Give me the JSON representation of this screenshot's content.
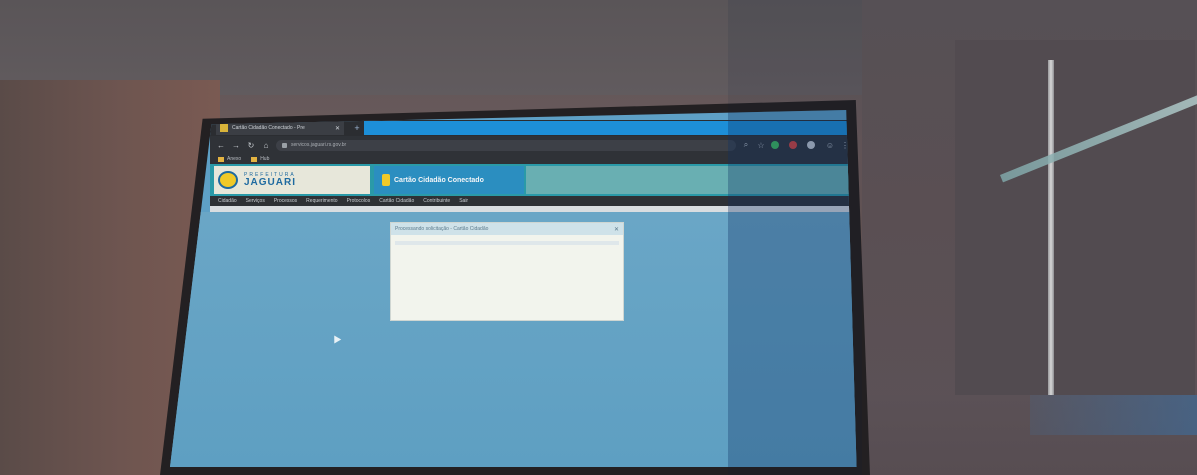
{
  "browser": {
    "tab_title": "Cartão Cidadão Conectado - Pre",
    "url": "servicos.jaguari.rs.gov.br",
    "bookmarks": [
      "Anexo",
      "Hub"
    ]
  },
  "site": {
    "logo_top": "PREFEITURA",
    "logo_name": "JAGUARI",
    "banner_title": "Cartão Cidadão Conectado",
    "menu": [
      "Cidadão",
      "Serviços",
      "Processos",
      "Requerimento",
      "Protocolos",
      "Cartão Cidadão",
      "Contribuinte",
      "Sair"
    ]
  },
  "dialog": {
    "title": "Processando solicitação - Cartão Cidadão",
    "progress": 0.0
  },
  "colors": {
    "screen_blue": "#5ea0c6",
    "header_teal": "#2a9aa8",
    "tab_blue": "#1d8fd8",
    "logo_yellow": "#f0c928"
  }
}
